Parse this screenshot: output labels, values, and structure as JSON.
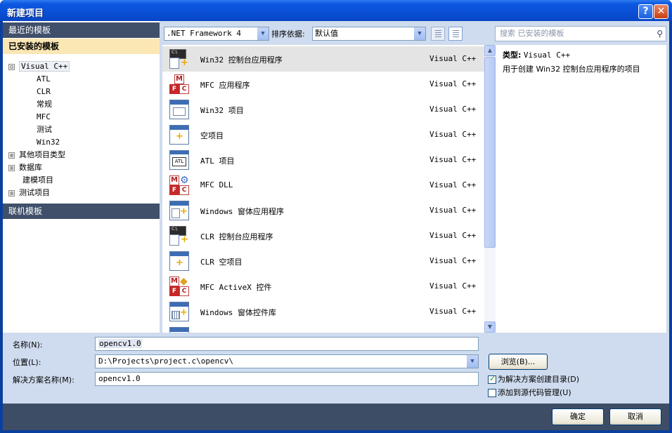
{
  "window": {
    "title": "新建项目",
    "help_symbol": "?",
    "close_symbol": "✕"
  },
  "left_panel": {
    "recent_label": "最近的模板",
    "installed_label": "已安装的模板",
    "online_label": "联机模板",
    "tree": [
      {
        "label": "Visual C++",
        "expander": "⊟",
        "level": 0
      },
      {
        "label": "ATL",
        "level": 1
      },
      {
        "label": "CLR",
        "level": 1
      },
      {
        "label": "常规",
        "level": 1
      },
      {
        "label": "MFC",
        "level": 1
      },
      {
        "label": "测试",
        "level": 1
      },
      {
        "label": "Win32",
        "level": 1
      },
      {
        "label": "其他项目类型",
        "expander": "⊞",
        "level": 0
      },
      {
        "label": "数据库",
        "expander": "⊞",
        "level": 0
      },
      {
        "label": "建模项目",
        "level": 0
      },
      {
        "label": "测试项目",
        "expander": "⊞",
        "level": 0
      }
    ]
  },
  "toolbar": {
    "framework_value": ".NET Framework 4",
    "sort_label": "排序依据:",
    "sort_value": "默认值"
  },
  "search": {
    "placeholder": "搜索 已安装的模板"
  },
  "templates": [
    {
      "name": "Win32 控制台应用程序",
      "lang": "Visual C++",
      "icon": "console-app-icon"
    },
    {
      "name": "MFC 应用程序",
      "lang": "Visual C++",
      "icon": "mfc-icon"
    },
    {
      "name": "Win32 项目",
      "lang": "Visual C++",
      "icon": "window-icon"
    },
    {
      "name": "空项目",
      "lang": "Visual C++",
      "icon": "empty-project-icon"
    },
    {
      "name": "ATL 项目",
      "lang": "Visual C++",
      "icon": "atl-icon"
    },
    {
      "name": "MFC DLL",
      "lang": "Visual C++",
      "icon": "mfc-dll-icon"
    },
    {
      "name": "Windows 窗体应用程序",
      "lang": "Visual C++",
      "icon": "forms-app-icon"
    },
    {
      "name": "CLR 控制台应用程序",
      "lang": "Visual C++",
      "icon": "console-app-icon"
    },
    {
      "name": "CLR 空项目",
      "lang": "Visual C++",
      "icon": "empty-project-icon"
    },
    {
      "name": "MFC ActiveX 控件",
      "lang": "Visual C++",
      "icon": "activex-icon"
    },
    {
      "name": "Windows 窗体控件库",
      "lang": "Visual C++",
      "icon": "control-library-icon"
    }
  ],
  "details": {
    "type_label": "类型:",
    "type_value": "Visual C++",
    "description": "用于创建 Win32 控制台应用程序的项目"
  },
  "form": {
    "name_label": "名称(N):",
    "name_value": "opencv1.0",
    "location_label": "位置(L):",
    "location_value": "D:\\Projects\\project.c\\opencv\\",
    "solution_label": "解决方案名称(M):",
    "solution_value": "opencv1.0",
    "browse_label": "浏览(B)...",
    "create_dir_label": "为解决方案创建目录(D)",
    "create_dir_checked": true,
    "source_control_label": "添加到源代码管理(U)",
    "source_control_checked": false
  },
  "footer": {
    "ok_label": "确定",
    "cancel_label": "取消"
  }
}
